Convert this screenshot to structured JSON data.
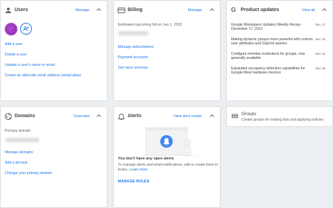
{
  "users": {
    "title": "Users",
    "manage_label": "Manage",
    "links": [
      "Add a user",
      "Delete a user",
      "Update a user's name or email",
      "Create an alternate email address (email alias)"
    ]
  },
  "billing": {
    "title": "Billing",
    "manage_label": "Manage",
    "estimate_text": "Estimated upcoming bill on Jan 1, 2022",
    "links": [
      "Manage subscriptions",
      "Payment accounts",
      "Get more services"
    ]
  },
  "product_updates": {
    "title": "Product updates",
    "view_all_label": "View all",
    "items": [
      {
        "title": "Google Workspace Updates Weekly Recap - December 17, 2021",
        "date": "Dec 17"
      },
      {
        "title": "Making dynamic groups more powerful with custom user attributes and OrgUnit queries",
        "date": "Dec 16"
      },
      {
        "title": "Configure member restrictions for groups, now generally available",
        "date": "Dec 16"
      },
      {
        "title": "Expanded occupancy detection capabilities for Google Meet hardware devices",
        "date": "Dec 15"
      }
    ]
  },
  "domains": {
    "title": "Domains",
    "overview_label": "Overview",
    "primary_label": "Primary domain",
    "links": [
      "Manage domains",
      "Add a domain",
      "Change your primary domain"
    ]
  },
  "alerts": {
    "title": "Alerts",
    "view_label": "View alert center",
    "empty_title": "You don't have any open alerts",
    "empty_text": "To manage alerts and email notifications, edit or create them in Rules.",
    "learn_more": "Learn more",
    "manage_rules": "MANAGE RULES"
  },
  "groups": {
    "title": "Groups",
    "subtitle": "Create groups for mailing lists and applying policies"
  },
  "colors": {
    "link": "#1a73e8",
    "avatar": "#9c27b0",
    "background": "#eceff1"
  }
}
